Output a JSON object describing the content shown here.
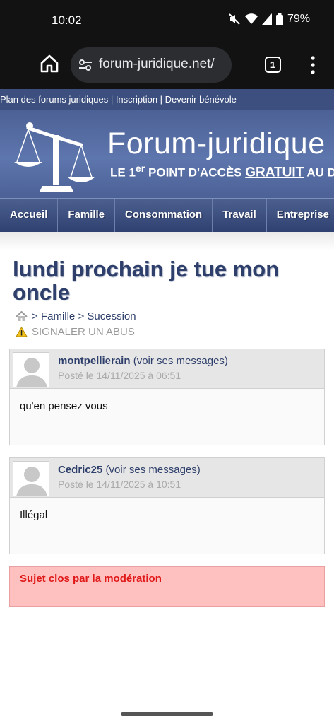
{
  "status": {
    "time": "10:02",
    "battery": "79%"
  },
  "browser": {
    "url": "forum-juridique.net/",
    "tab_count": "1"
  },
  "toplinks": {
    "plan": "Plan des forums juridiques",
    "sep1": " | ",
    "inscription": "Inscription",
    "sep2": " | ",
    "benevole": "Devenir bénévole"
  },
  "banner": {
    "brand": "Forum-juridique",
    "tagline_a": "LE 1",
    "tagline_sup": "er",
    "tagline_b": " POINT D'ACCÈS ",
    "tagline_gratuit": "GRATUIT",
    "tagline_c": " AU DRO"
  },
  "nav": [
    "Accueil",
    "Famille",
    "Consommation",
    "Travail",
    "Entreprise"
  ],
  "thread": {
    "title": "lundi prochain je tue mon oncle",
    "breadcrumb": {
      "sep1": "> ",
      "cat1": "Famille",
      "sep2": " > ",
      "cat2": "Sucession"
    },
    "report": "SIGNALER UN ABUS"
  },
  "posts": [
    {
      "author": "montpellierain",
      "link": "(voir ses messages)",
      "date": "Posté le 14/11/2025 à 06:51",
      "text": "qu'en pensez vous"
    },
    {
      "author": "Cedric25",
      "link": "(voir ses messages)",
      "date": "Posté le 14/11/2025 à 10:51",
      "text": "Illégal"
    }
  ],
  "closed_notice": "Sujet clos par la modération",
  "colors": {
    "accent": "#2e3f6b",
    "nav": "#3c4f7e",
    "closed_bg": "#ffc0c0",
    "closed_text": "#e01818"
  }
}
